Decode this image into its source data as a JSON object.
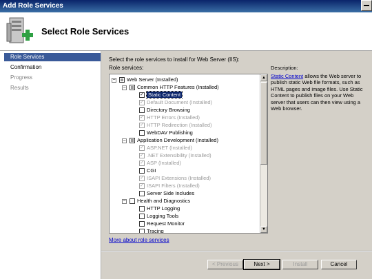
{
  "window": {
    "title": "Add Role Services"
  },
  "header": {
    "title": "Select Role Services",
    "icon": "server-add-icon"
  },
  "steps": [
    {
      "label": "Role Services",
      "active": true
    },
    {
      "label": "Confirmation"
    },
    {
      "label": "Progress"
    },
    {
      "label": "Results"
    }
  ],
  "main": {
    "instruction": "Select the role services to install for Web Server (IIS):",
    "role_services_label": "Role services:",
    "description_title": "Description:",
    "description_link": "Static Content",
    "description_text": "allows the Web server to publish static Web file formats, such as HTML pages and image files. Use Static Content to publish files on your Web server that users can then view using a Web browser.",
    "more_link": "More about role services"
  },
  "tree": [
    {
      "label": "Web Server  (Installed)"
    },
    {
      "label": "Common HTTP Features  (Installed)"
    },
    {
      "label": "Static Content"
    },
    {
      "label": "Default Document  (Installed)"
    },
    {
      "label": "Directory Browsing"
    },
    {
      "label": "HTTP Errors  (Installed)"
    },
    {
      "label": "HTTP Redirection  (Installed)"
    },
    {
      "label": "WebDAV Publishing"
    },
    {
      "label": "Application Development  (Installed)"
    },
    {
      "label": "ASP.NET  (Installed)"
    },
    {
      "label": ".NET Extensibility  (Installed)"
    },
    {
      "label": "ASP  (Installed)"
    },
    {
      "label": "CGI"
    },
    {
      "label": "ISAPI Extensions  (Installed)"
    },
    {
      "label": "ISAPI Filters  (Installed)"
    },
    {
      "label": "Server Side Includes"
    },
    {
      "label": "Health and Diagnostics"
    },
    {
      "label": "HTTP Logging"
    },
    {
      "label": "Logging Tools"
    },
    {
      "label": "Request Monitor"
    },
    {
      "label": "Tracing"
    }
  ],
  "buttons": {
    "previous": "< Previous",
    "next": "Next >",
    "install": "Install",
    "cancel": "Cancel"
  },
  "colors": {
    "titlebar": "#0a246a",
    "active_step": "#3a5a99",
    "dialog_bg": "#d4d0c8"
  }
}
